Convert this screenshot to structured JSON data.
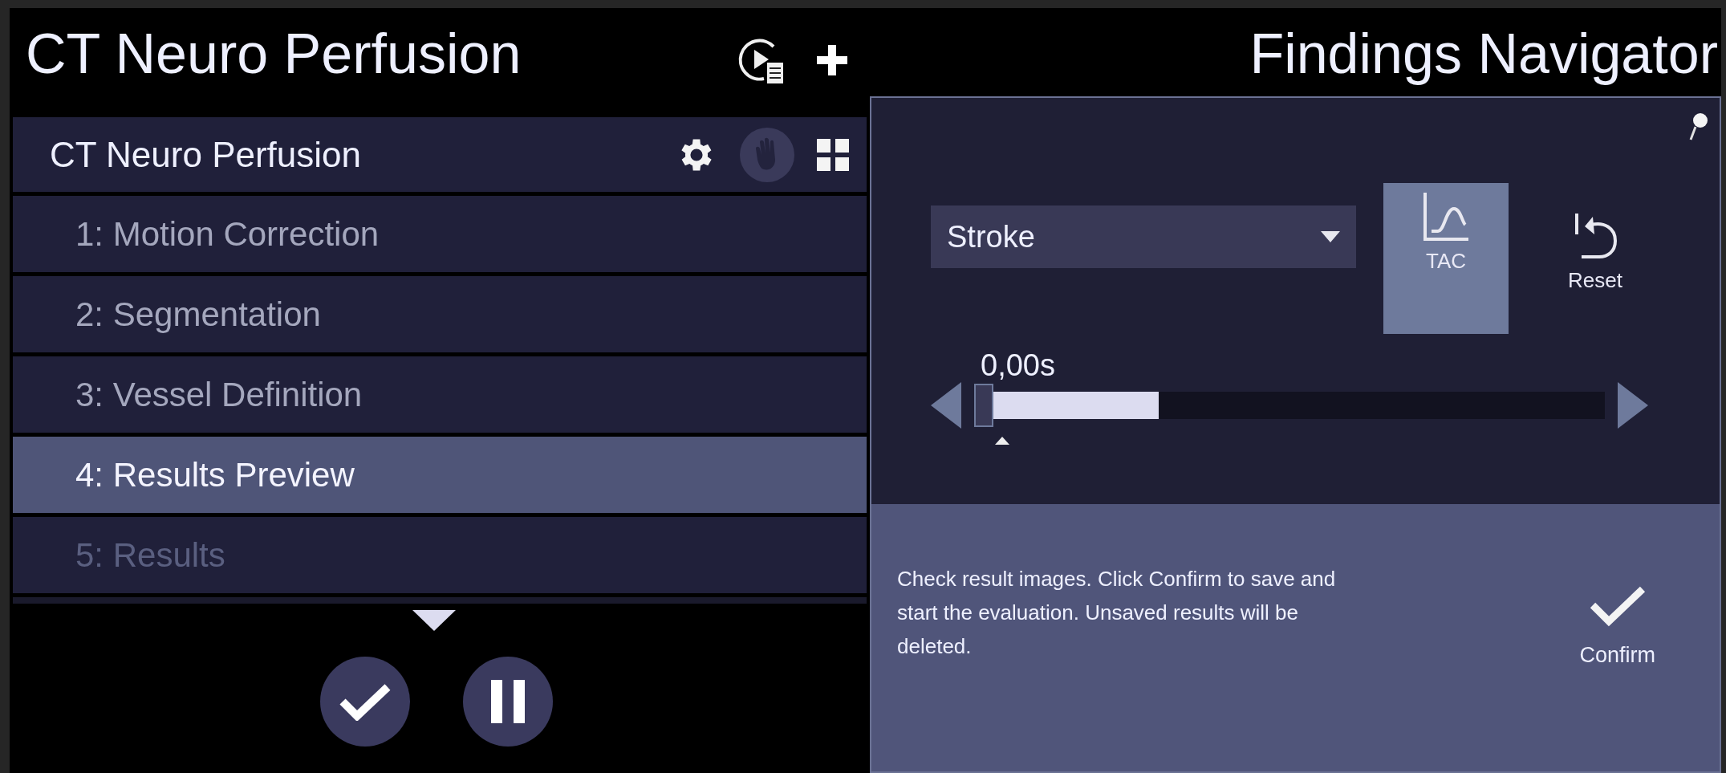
{
  "left_title": "CT Neuro Perfusion",
  "workflow": {
    "title": "CT Neuro Perfusion",
    "steps": [
      {
        "label": "1: Motion Correction",
        "selected": false,
        "disabled": false
      },
      {
        "label": "2: Segmentation",
        "selected": false,
        "disabled": false
      },
      {
        "label": "3: Vessel Definition",
        "selected": false,
        "disabled": false
      },
      {
        "label": "4: Results Preview",
        "selected": true,
        "disabled": false
      },
      {
        "label": "5: Results",
        "selected": false,
        "disabled": true
      }
    ]
  },
  "right_title": "Findings Navigator",
  "navigator": {
    "dropdown": {
      "value": "Stroke"
    },
    "tools": [
      {
        "kind": "tac",
        "label": "TAC",
        "selected": true
      },
      {
        "kind": "reset",
        "label": "Reset",
        "selected": false
      }
    ],
    "time_slider": {
      "reading": "0,00s",
      "level": 0.27
    },
    "message": "Check result images. Click Confirm to save and start the evaluation. Unsaved results will be deleted.",
    "confirm": {
      "label": "Confirm"
    }
  }
}
